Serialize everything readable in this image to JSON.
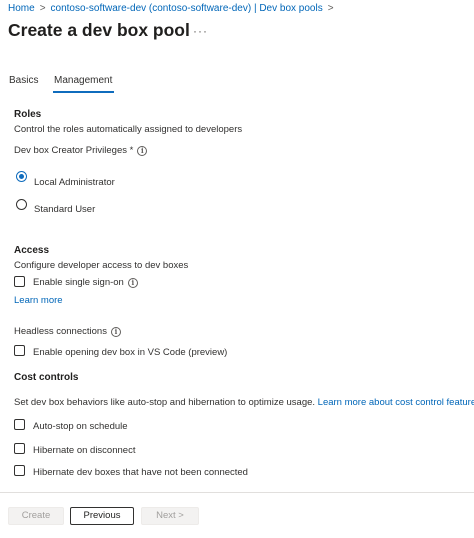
{
  "breadcrumb": {
    "items": [
      "Home",
      "contoso-software-dev (contoso-software-dev) | Dev box pools"
    ],
    "separator": ">"
  },
  "page": {
    "title": "Create a dev box pool",
    "more_label": "···"
  },
  "tabs": [
    {
      "label": "Basics",
      "active": false
    },
    {
      "label": "Management",
      "active": true
    }
  ],
  "roles": {
    "title": "Roles",
    "description": "Control the roles automatically assigned to developers",
    "privileges_label": "Dev box Creator Privileges *",
    "options": [
      {
        "label": "Local Administrator",
        "selected": true
      },
      {
        "label": "Standard User",
        "selected": false
      }
    ]
  },
  "access": {
    "title": "Access",
    "description": "Configure developer access to dev boxes",
    "sso_label": "Enable single sign-on",
    "sso_checked": false,
    "learn_more": "Learn more",
    "headless_label": "Headless connections",
    "vscode_label": "Enable opening dev box in VS Code (preview)",
    "vscode_checked": false
  },
  "cost": {
    "title": "Cost controls",
    "description": "Set dev box behaviors like auto-stop and hibernation to optimize usage.",
    "learn_more": "Learn more about cost control features",
    "options": [
      {
        "label": "Auto-stop on schedule",
        "checked": false
      },
      {
        "label": "Hibernate on disconnect",
        "checked": false
      },
      {
        "label": "Hibernate dev boxes that have not been connected",
        "checked": false
      }
    ]
  },
  "footer": {
    "create": "Create",
    "previous": "Previous",
    "next": "Next >"
  },
  "colors": {
    "accent": "#0f6cbd",
    "link": "#0066b8",
    "disabled_button_bg": "#f3f2f1"
  },
  "icons": {
    "info": "info-circle-icon",
    "breadcrumb_separator": "chevron-right-icon"
  }
}
